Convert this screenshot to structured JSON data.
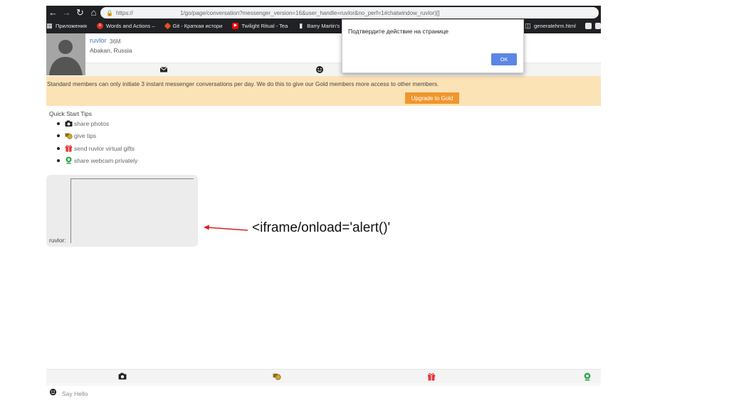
{
  "browser": {
    "url": "https://1/go/page/conversation?messenger_version=16&user_handle=ruvlor&no_perf=1#chatwindow_ruvlor)[]",
    "url_prefix": "https://",
    "url_path": "1/go/page/conversation?messenger_version=16&user_handle=ruvlor&no_perf=1#chatwindow_ruvlor)[]",
    "bookmarks": [
      {
        "label": "Приложения",
        "icon": "apps-grid-icon",
        "color": "#e8e8e8"
      },
      {
        "label": "Words and Actions –",
        "icon": "site-icon",
        "color": "#d93025"
      },
      {
        "label": "Git - Краткая истори",
        "icon": "git-icon",
        "color": "#e44d26"
      },
      {
        "label": "Twilight Ritual - Tea",
        "icon": "youtube-icon",
        "color": "#ff0000"
      },
      {
        "label": "Barry Martin's Hopali",
        "icon": "bookmark-icon",
        "color": "#e8e8e8"
      }
    ],
    "bookmark_right": {
      "label": "generatehrm.html",
      "icon": "file-icon"
    }
  },
  "profile": {
    "name": "ruvlor",
    "age_gender": "36M",
    "location": "Abakan, Russia"
  },
  "banner": {
    "text": "Standard members can only initiate 3 instant messenger conversations per day. We do this to give our Gold members more access to other members.",
    "upgrade_label": "Upgrade to Gold"
  },
  "tips": {
    "title": "Quick Start Tips",
    "items": [
      {
        "label": "share photos",
        "icon": "camera-icon"
      },
      {
        "label": "give tips",
        "icon": "tip-coins-icon"
      },
      {
        "label": "send ruvlor virtual gifts",
        "icon": "gift-icon"
      },
      {
        "label": "share webcam privately",
        "icon": "webcam-icon"
      }
    ]
  },
  "chat": {
    "sender_label": "ruvlor:",
    "annotation": "<iframe/onload='alert()'"
  },
  "message": {
    "placeholder": "Say Hello"
  },
  "dialog": {
    "message": "Подтвердите действие на странице",
    "ok_label": "OK"
  },
  "colors": {
    "banner_bg": "#fbe3b6",
    "upgrade_button": "#f0962d",
    "dialog_ok": "#5b86e5",
    "arrow": "#d9211e",
    "webcam_green": "#2ea84a",
    "gift_red": "#e0393e"
  }
}
